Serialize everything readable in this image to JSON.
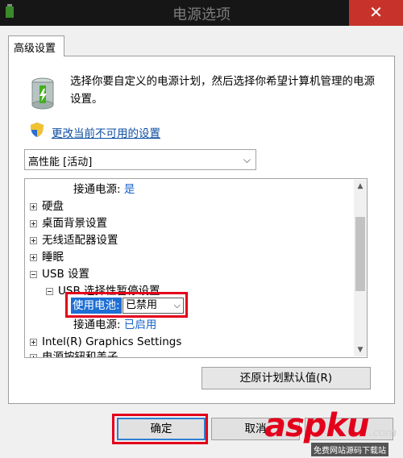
{
  "window": {
    "title": "电源选项",
    "close_glyph": "✕"
  },
  "tab": {
    "label": "高级设置"
  },
  "description": "选择你要自定义的电源计划，然后选择你希望计算机管理的电源设置。",
  "link": "更改当前不可用的设置",
  "plan_select": {
    "value": "高性能 [活动]"
  },
  "tree": {
    "items": [
      {
        "label": "接通电源:",
        "value": "是"
      },
      {
        "label": "硬盘",
        "expander": "+"
      },
      {
        "label": "桌面背景设置",
        "expander": "+"
      },
      {
        "label": "无线适配器设置",
        "expander": "+"
      },
      {
        "label": "睡眠",
        "expander": "+"
      },
      {
        "label": "USB 设置",
        "expander": "-"
      },
      {
        "label": "USB 选择性暂停设置",
        "expander": "-"
      },
      {
        "label": "使用电池:",
        "value": "已禁用"
      },
      {
        "label": "接通电源:",
        "value": "已启用"
      },
      {
        "label": "Intel(R) Graphics Settings",
        "expander": "+"
      },
      {
        "label": "电源按钮和盖子",
        "expander": "+"
      }
    ]
  },
  "buttons": {
    "restore": "还原计划默认值(R)",
    "ok": "确定",
    "cancel": "取消"
  },
  "watermark": {
    "brand": "aspku",
    "suffix": ".com",
    "sub": "免费网站源码下载站"
  },
  "colors": {
    "highlight": "#e3001b",
    "link": "#0c4ea1",
    "value_blue": "#1a64c8",
    "close": "#c7332b"
  }
}
